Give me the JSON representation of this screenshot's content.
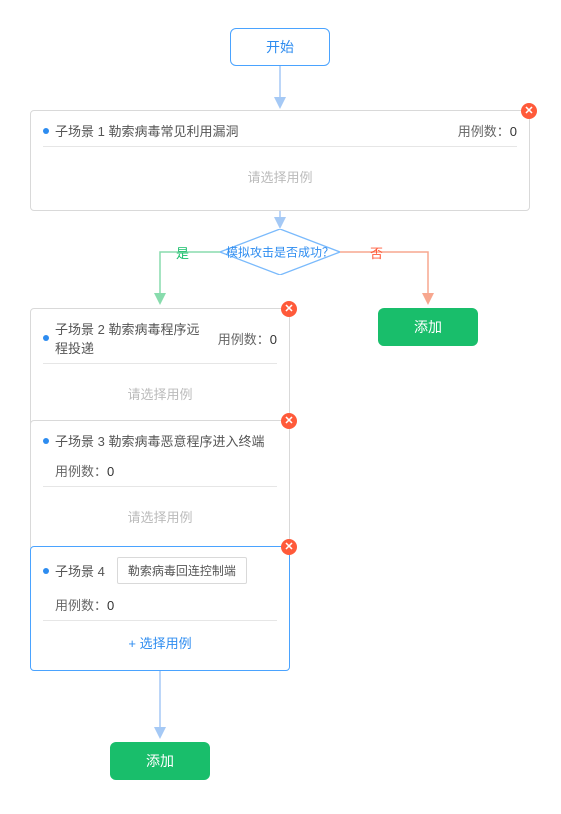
{
  "start": {
    "label": "开始"
  },
  "decision": {
    "text": "模拟攻击是否成功？",
    "yes_label": "是",
    "no_label": "否"
  },
  "scenes": {
    "s1": {
      "title": "子场景 1   勒索病毒常见利用漏洞",
      "count_label": "用例数：",
      "count": "0",
      "placeholder": "请选择用例"
    },
    "s2": {
      "title": "子场景 2   勒索病毒程序远程投递",
      "count_label": "用例数：",
      "count": "0",
      "placeholder": "请选择用例"
    },
    "s3": {
      "title": "子场景 3   勒索病毒恶意程序进入终端",
      "count_label": "用例数：",
      "count": "0",
      "placeholder": "请选择用例"
    },
    "s4": {
      "title": "子场景 4",
      "tag": "勒索病毒回连控制端",
      "count_label": "用例数：",
      "count": "0",
      "select_cta": "+ 选择用例"
    }
  },
  "buttons": {
    "add": "添加"
  }
}
